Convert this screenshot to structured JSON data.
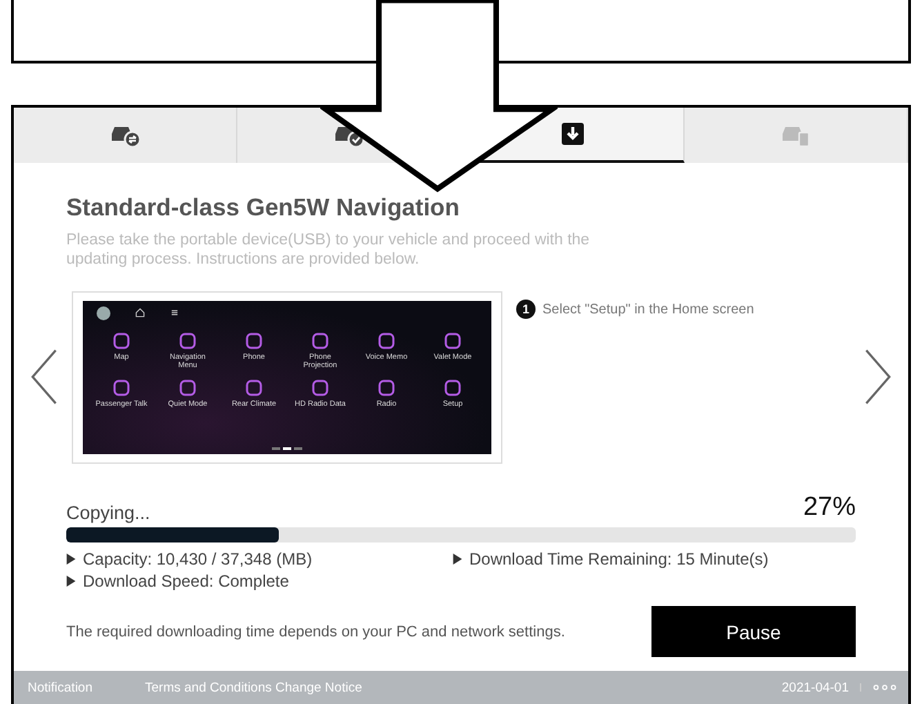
{
  "steps": [
    {
      "kind": "swap",
      "selected": false,
      "disabled": false
    },
    {
      "kind": "check",
      "selected": false,
      "disabled": false
    },
    {
      "kind": "download",
      "selected": true,
      "disabled": false
    },
    {
      "kind": "device",
      "selected": false,
      "disabled": true
    }
  ],
  "title": "Standard-class Gen5W Navigation",
  "description": "Please take the portable device(USB) to your vehicle and proceed with the updating process. Instructions are provided below.",
  "slide": {
    "home_screen": {
      "apps": [
        {
          "label": "Map"
        },
        {
          "label": "Navigation Menu"
        },
        {
          "label": "Phone"
        },
        {
          "label": "Phone Projection"
        },
        {
          "label": "Voice Memo"
        },
        {
          "label": "Valet Mode"
        },
        {
          "label": "Passenger Talk"
        },
        {
          "label": "Quiet Mode"
        },
        {
          "label": "Rear Climate"
        },
        {
          "label": "HD Radio Data"
        },
        {
          "label": "Radio"
        },
        {
          "label": "Setup"
        }
      ],
      "pages": [
        {
          "selected": false
        },
        {
          "selected": true
        },
        {
          "selected": false
        }
      ]
    },
    "step_number": "1",
    "instruction": "Select \"Setup\" in the Home screen"
  },
  "progress": {
    "status": "Copying...",
    "percent": "27%",
    "level": 0.27
  },
  "info": [
    {
      "text": "Capacity: 10,430 / 37,348 (MB)"
    },
    {
      "text": "Download Time Remaining: 15 Minute(s)"
    },
    {
      "text": "Download Speed: Complete"
    }
  ],
  "note": "The required downloading time depends on your PC and network settings.",
  "pause_button": "Pause",
  "footer": {
    "links": [
      "Notification",
      "Terms and Conditions Change Notice"
    ],
    "date": "2021-04-01"
  }
}
